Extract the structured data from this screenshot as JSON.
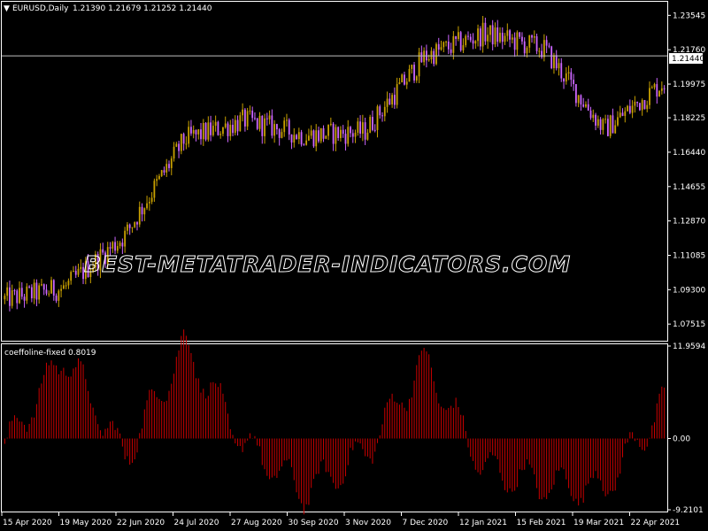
{
  "main_chart": {
    "header": {
      "arrow": "▼",
      "title": "EURUSD,Daily",
      "ohlc": "1.21390 1.21679 1.21252 1.21440"
    },
    "y_ticks": [
      "1.23545",
      "1.21760",
      "1.19975",
      "1.18225",
      "1.16440",
      "1.14655",
      "1.12870",
      "1.11085",
      "1.09300",
      "1.07515"
    ],
    "current_price_label": "1.21440",
    "watermark": "BEST-METATRADER-INDICATORS.COM",
    "colors": {
      "bull": "#c8a000",
      "bear": "#cc66ff",
      "grid_line": "#c0c0c0",
      "price_box": "#ffffff"
    }
  },
  "indicator": {
    "title": "coeffoline-fixed 0.8019",
    "y_ticks": [
      "11.9594",
      "0.00",
      "-9.2101"
    ],
    "color": "#cc0000"
  },
  "x_axis": {
    "labels": [
      "15 Apr 2020",
      "19 May 2020",
      "22 Jun 2020",
      "24 Jul 2020",
      "27 Aug 2020",
      "30 Sep 2020",
      "3 Nov 2020",
      "7 Dec 2020",
      "12 Jan 2021",
      "15 Feb 2021",
      "19 Mar 2021",
      "22 Apr 2021"
    ]
  },
  "chart_data": [
    {
      "type": "candlestick",
      "title": "EURUSD,Daily",
      "ylim": [
        1.0665,
        1.2425
      ],
      "x": [
        "15 Apr 2020",
        "19 May 2020",
        "22 Jun 2020",
        "24 Jul 2020",
        "27 Aug 2020",
        "30 Sep 2020",
        "3 Nov 2020",
        "7 Dec 2020",
        "12 Jan 2021",
        "15 Feb 2021",
        "19 Mar 2021",
        "22 Apr 2021"
      ],
      "close_path_by_label": [
        1.088,
        1.094,
        1.121,
        1.171,
        1.181,
        1.173,
        1.175,
        1.214,
        1.226,
        1.218,
        1.176,
        1.201
      ],
      "last_ohlc": {
        "open": 1.2139,
        "high": 1.21679,
        "low": 1.21252,
        "close": 1.2144
      }
    },
    {
      "type": "bar",
      "title": "coeffoline-fixed 0.8019",
      "ylim": [
        -9.2101,
        11.9594
      ],
      "x_labels": [
        "15 Apr 2020",
        "19 May 2020",
        "22 Jun 2020",
        "24 Jul 2020",
        "27 Aug 2020",
        "30 Sep 2020",
        "3 Nov 2020",
        "7 Dec 2020",
        "12 Jan 2021",
        "15 Feb 2021",
        "19 Mar 2021",
        "22 Apr 2021"
      ],
      "values_approx_by_label": [
        -1.2,
        11.0,
        -2.5,
        12.0,
        -0.8,
        -7.0,
        -2.0,
        10.0,
        -4.0,
        -6.0,
        -6.5,
        4.5
      ]
    }
  ]
}
